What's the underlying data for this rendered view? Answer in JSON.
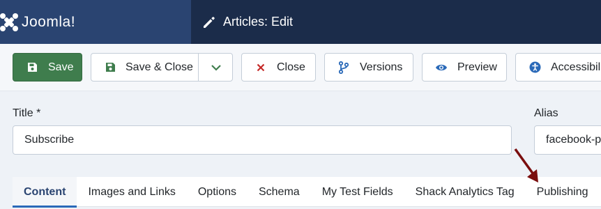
{
  "header": {
    "logo_text": "Joomla!",
    "page_title": "Articles: Edit",
    "colors": {
      "logo_bg": "#2a4471",
      "bar_bg": "#1b2c4a"
    }
  },
  "toolbar": {
    "save_label": "Save",
    "save_close_label": "Save & Close",
    "close_label": "Close",
    "versions_label": "Versions",
    "preview_label": "Preview",
    "accessibility_label": "Accessibili",
    "colors": {
      "save_bg": "#3f7d4d",
      "close_icon": "#c52827",
      "icon_blue": "#2a69b8"
    }
  },
  "form": {
    "title_label": "Title *",
    "title_value": "Subscribe",
    "alias_label": "Alias",
    "alias_value": "facebook-p"
  },
  "tabs": [
    {
      "label": "Content",
      "active": true
    },
    {
      "label": "Images and Links",
      "active": false
    },
    {
      "label": "Options",
      "active": false
    },
    {
      "label": "Schema",
      "active": false
    },
    {
      "label": "My Test Fields",
      "active": false
    },
    {
      "label": "Shack Analytics Tag",
      "active": false
    },
    {
      "label": "Publishing",
      "active": false
    }
  ],
  "annotation": {
    "color": "#7a0e0e",
    "points_to": "Publishing"
  }
}
